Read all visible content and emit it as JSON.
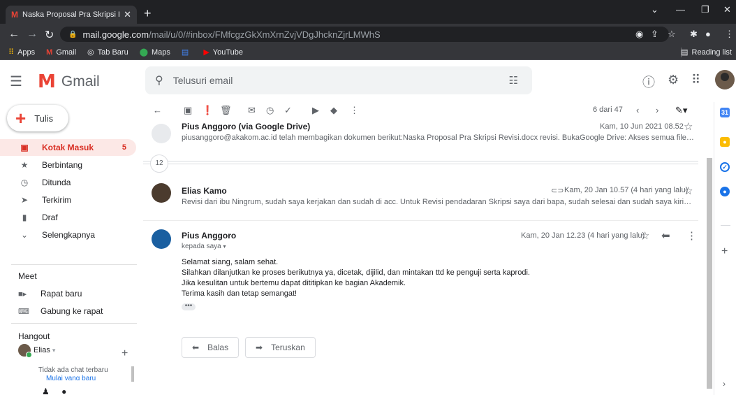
{
  "browser": {
    "tab_title": "Naska Proposal Pra Skripsi Revisi",
    "url_host": "mail.google.com",
    "url_path": "/mail/u/0/#inbox/FMfcgzGkXmXrnZvjVDgJhcknZjrLMWhS",
    "bookmarks": [
      {
        "label": "Apps",
        "icon": "apps-grid-icon"
      },
      {
        "label": "Gmail",
        "icon": "gmail-icon"
      },
      {
        "label": "Tab Baru",
        "icon": "chrome-icon"
      },
      {
        "label": "Maps",
        "icon": "maps-pin-icon"
      },
      {
        "label": "",
        "icon": "docs-icon"
      },
      {
        "label": "YouTube",
        "icon": "youtube-icon"
      }
    ],
    "reading_list": "Reading list"
  },
  "gmail": {
    "app_name": "Gmail",
    "search_placeholder": "Telusuri email",
    "compose_label": "Tulis",
    "nav": [
      {
        "label": "Kotak Masuk",
        "count": "5",
        "icon": "inbox-icon"
      },
      {
        "label": "Berbintang",
        "count": "",
        "icon": "star-icon"
      },
      {
        "label": "Ditunda",
        "count": "",
        "icon": "clock-icon"
      },
      {
        "label": "Terkirim",
        "count": "",
        "icon": "send-icon"
      },
      {
        "label": "Draf",
        "count": "",
        "icon": "draft-icon"
      },
      {
        "label": "Selengkapnya",
        "count": "",
        "icon": "chevron-down-icon"
      }
    ],
    "meet": {
      "header": "Meet",
      "new_meeting": "Rapat baru",
      "join_meeting": "Gabung ke rapat"
    },
    "hangout": {
      "header": "Hangout",
      "user": "Elias",
      "no_chats": "Tidak ada chat terbaru",
      "start_new": "Mulai yang baru"
    }
  },
  "thread": {
    "pager": "6 dari 47",
    "collapsed_count": "12",
    "messages": [
      {
        "sender": "Pius Anggoro (via Google Drive)",
        "snippet": "piusanggoro@akakom.ac.id telah membagikan dokumen berikut:Naska Proposal Pra Skripsi Revisi.docx revisi. BukaGoogle Drive: Akses semua file Anda de...",
        "date": "Kam, 10 Jun 2021 08.52"
      },
      {
        "sender": "Elias Kamo",
        "snippet": "Revisi dari ibu Ningrum, sudah saya kerjakan dan sudah di acc. Untuk Revisi pendadaran Skripsi saya dari bapa, sudah selesai dan sudah saya kirim melalui...",
        "date": "Kam, 20 Jan 10.57 (4 hari yang lalu)"
      }
    ],
    "open_message": {
      "sender": "Pius Anggoro",
      "to": "kepada saya",
      "date": "Kam, 20 Jan 12.23 (4 hari yang lalu)",
      "body": [
        "Selamat siang, salam sehat.",
        "Silahkan dilanjutkan ke proses berikutnya ya, dicetak, dijilid, dan mintakan ttd ke penguji serta kaprodi.",
        "Jika kesulitan untuk bertemu dapat dititipkan ke bagian Akademik.",
        "Terima kasih dan tetap semangat!"
      ],
      "reply_label": "Balas",
      "forward_label": "Teruskan"
    }
  }
}
